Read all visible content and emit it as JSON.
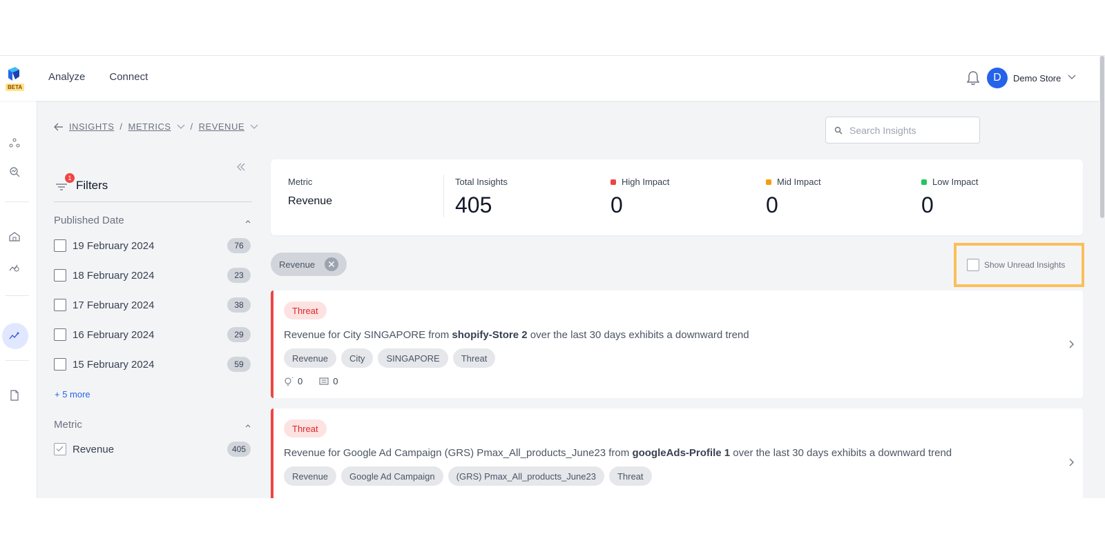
{
  "nav": {
    "items": [
      "Analyze",
      "Connect"
    ],
    "logo_badge": "BETA"
  },
  "user": {
    "initial": "D",
    "store": "Demo Store"
  },
  "breadcrumb": {
    "level1": "INSIGHTS",
    "level2": "METRICS",
    "level3": "REVENUE"
  },
  "search": {
    "placeholder": "Search Insights",
    "value": ""
  },
  "filters": {
    "title": "Filters",
    "badge": "1",
    "published_date": {
      "label": "Published Date",
      "items": [
        {
          "label": "19 February 2024",
          "count": "76"
        },
        {
          "label": "18 February 2024",
          "count": "23"
        },
        {
          "label": "17 February 2024",
          "count": "38"
        },
        {
          "label": "16 February 2024",
          "count": "29"
        },
        {
          "label": "15 February 2024",
          "count": "59"
        }
      ],
      "more": "+ 5 more"
    },
    "metric": {
      "label": "Metric",
      "items": [
        {
          "label": "Revenue",
          "count": "405",
          "checked": true
        }
      ]
    }
  },
  "summary": {
    "metric_label": "Metric",
    "metric_value": "Revenue",
    "total_label": "Total Insights",
    "total_value": "405",
    "high_label": "High Impact",
    "high_value": "0",
    "high_color": "#ef4444",
    "mid_label": "Mid Impact",
    "mid_value": "0",
    "mid_color": "#f59e0b",
    "low_label": "Low Impact",
    "low_value": "0",
    "low_color": "#22c55e"
  },
  "active_filter": {
    "label": "Revenue"
  },
  "unread": {
    "label": "Show Unread Insights"
  },
  "cards": [
    {
      "tag": "Threat",
      "title_pre": "Revenue for City SINGAPORE from ",
      "title_bold": "shopify-Store 2",
      "title_post": " over the last 30 days exhibits a downward trend",
      "tags": [
        "Revenue",
        "City",
        "SINGAPORE",
        "Threat"
      ],
      "ideas": "0",
      "comments": "0"
    },
    {
      "tag": "Threat",
      "title_pre": "Revenue for Google Ad Campaign (GRS) Pmax_All_products_June23 from ",
      "title_bold": "googleAds-Profile 1",
      "title_post": " over the last 30 days exhibits a downward trend",
      "tags": [
        "Revenue",
        "Google Ad Campaign",
        "(GRS) Pmax_All_products_June23",
        "Threat"
      ]
    }
  ]
}
